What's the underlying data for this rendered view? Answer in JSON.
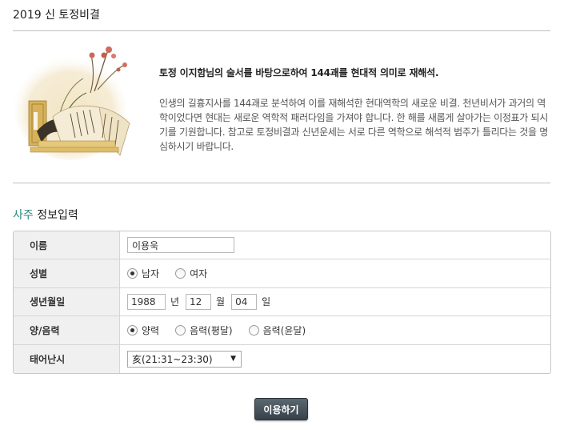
{
  "page": {
    "title": "2019 신 토정비결"
  },
  "intro": {
    "headline": "토정 이지함님의 술서를 바탕으로하여 144괘를 현대적 의미로 재해석.",
    "body": "인생의 길흉지사를 144괘로 분석하여 이를 재해석한 현대역학의 새로운 비결. 천년비서가 과거의 역학이었다면 현대는 새로운 역학적 패러다임을 가져야 합니다. 한 해를 새롭게 살아가는 이정표가 되시기를 기원합니다. 참고로 토정비결과 신년운세는 서로 다른 역학으로 해석적 범주가 틀리다는 것을 명심하시기 바랍니다."
  },
  "section": {
    "title_accent": "사주",
    "title_rest": " 정보입력"
  },
  "form": {
    "name": {
      "label": "이름",
      "value": "이용욱"
    },
    "gender": {
      "label": "성별",
      "options": [
        "남자",
        "여자"
      ],
      "selected": "남자"
    },
    "birth": {
      "label": "생년월일",
      "year": "1988",
      "year_unit": "년",
      "month": "12",
      "month_unit": "월",
      "day": "04",
      "day_unit": "일"
    },
    "calendar": {
      "label": "양/음력",
      "options": [
        "양력",
        "음력(평달)",
        "음력(윤달)"
      ],
      "selected": "양력"
    },
    "birth_time": {
      "label": "태어난시",
      "selected": "亥(21:31~23:30)"
    }
  },
  "submit": {
    "label": "이용하기"
  },
  "colors": {
    "accent": "#2c8a80",
    "button": "#3f4a52"
  }
}
